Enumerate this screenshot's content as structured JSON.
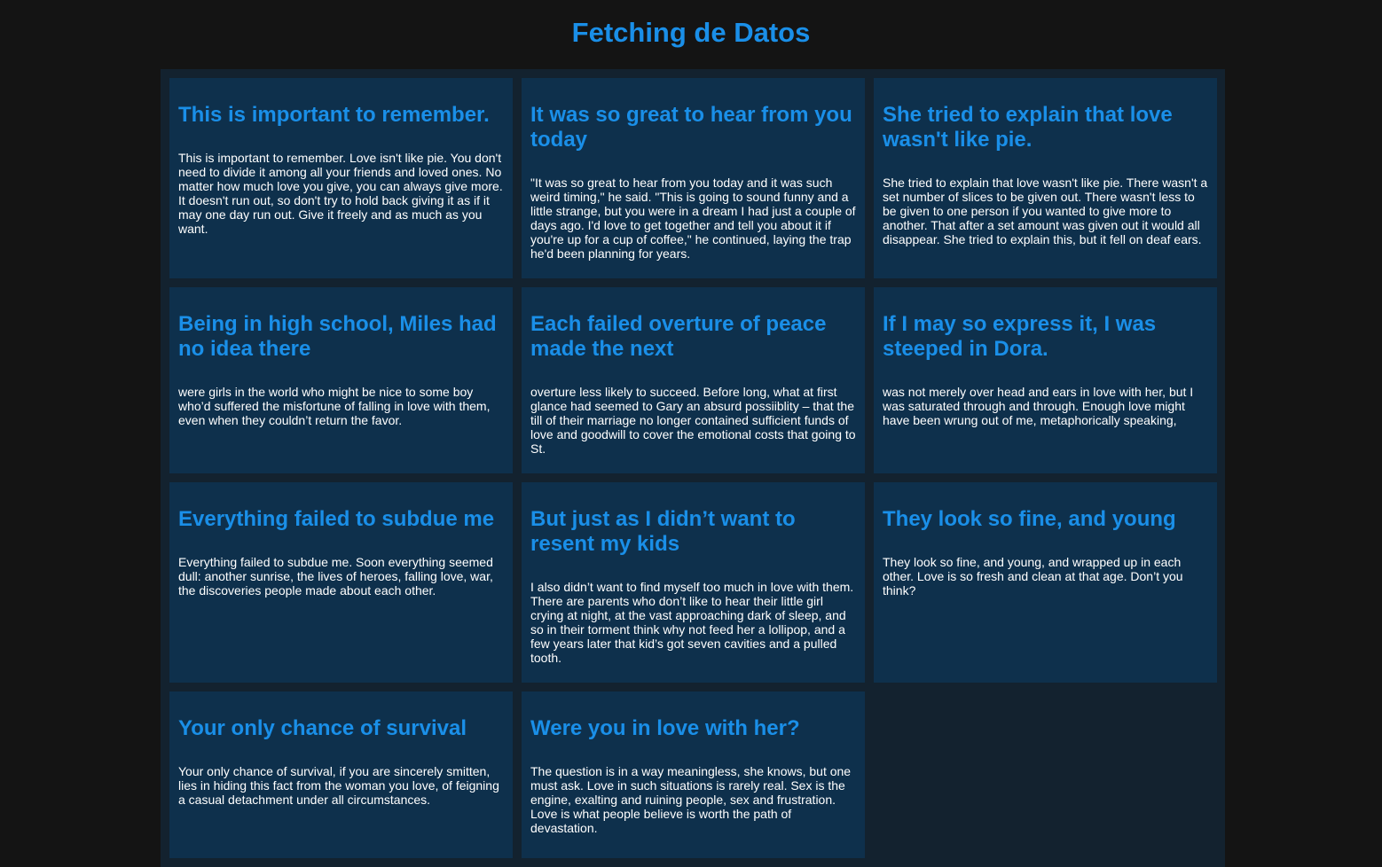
{
  "page": {
    "title": "Fetching de Datos"
  },
  "colors": {
    "background": "#141414",
    "grid_background": "#13222f",
    "card_background": "#0e304c",
    "accent": "#1a8fe8",
    "text": "#ffffff"
  },
  "cards": [
    {
      "title": "This is important to remember.",
      "body": "This is important to remember. Love isn't like pie. You don't need to divide it among all your friends and loved ones. No matter how much love you give, you can always give more. It doesn't run out, so don't try to hold back giving it as if it may one day run out. Give it freely and as much as you want."
    },
    {
      "title": "It was so great to hear from you today",
      "body": "\"It was so great to hear from you today and it was such weird timing,\" he said. \"This is going to sound funny and a little strange, but you were in a dream I had just a couple of days ago. I'd love to get together and tell you about it if you're up for a cup of coffee,\" he continued, laying the trap he'd been planning for years."
    },
    {
      "title": "She tried to explain that love wasn't like pie.",
      "body": "She tried to explain that love wasn't like pie. There wasn't a set number of slices to be given out. There wasn't less to be given to one person if you wanted to give more to another. That after a set amount was given out it would all disappear. She tried to explain this, but it fell on deaf ears."
    },
    {
      "title": "Being in high school, Miles had no idea there",
      "body": "were girls in the world who might be nice to some boy who’d suffered the misfortune of falling in love with them, even when they couldn’t return the favor."
    },
    {
      "title": "Each failed overture of peace made the next",
      "body": "overture less likely to succeed. Before long, what at first glance had seemed to Gary an absurd possiiblity – that the till of their marriage no longer contained sufficient funds of love and goodwill to cover the emotional costs that going to St."
    },
    {
      "title": "If I may so express it, I was steeped in Dora.",
      "body": "was not merely over head and ears in love with her, but I was saturated through and through. Enough love might have been wrung out of me, metaphorically speaking,"
    },
    {
      "title": "Everything failed to subdue me",
      "body": "Everything failed to subdue me. Soon everything seemed dull: another sunrise, the lives of heroes, falling love, war, the discoveries people made about each other."
    },
    {
      "title": "But just as I didn’t want to resent my kids",
      "body": "I also didn’t want to find myself too much in love with them. There are parents who don’t like to hear their little girl crying at night, at the vast approaching dark of sleep, and so in their torment think why not feed her a lollipop, and a few years later that kid’s got seven cavities and a pulled tooth."
    },
    {
      "title": "They look so fine, and young",
      "body": "They look so fine, and young, and wrapped up in each other. Love is so fresh and clean at that age. Don’t you think?"
    },
    {
      "title": "Your only chance of survival",
      "body": "Your only chance of survival, if you are sincerely smitten, lies in hiding this fact from the woman you love, of feigning a casual detachment under all circumstances."
    },
    {
      "title": "Were you in love with her?",
      "body": "The question is in a way meaningless, she knows, but one must ask. Love in such situations is rarely real. Sex is the engine, exalting and ruining people, sex and frustration. Love is what people believe is worth the path of devastation."
    }
  ]
}
